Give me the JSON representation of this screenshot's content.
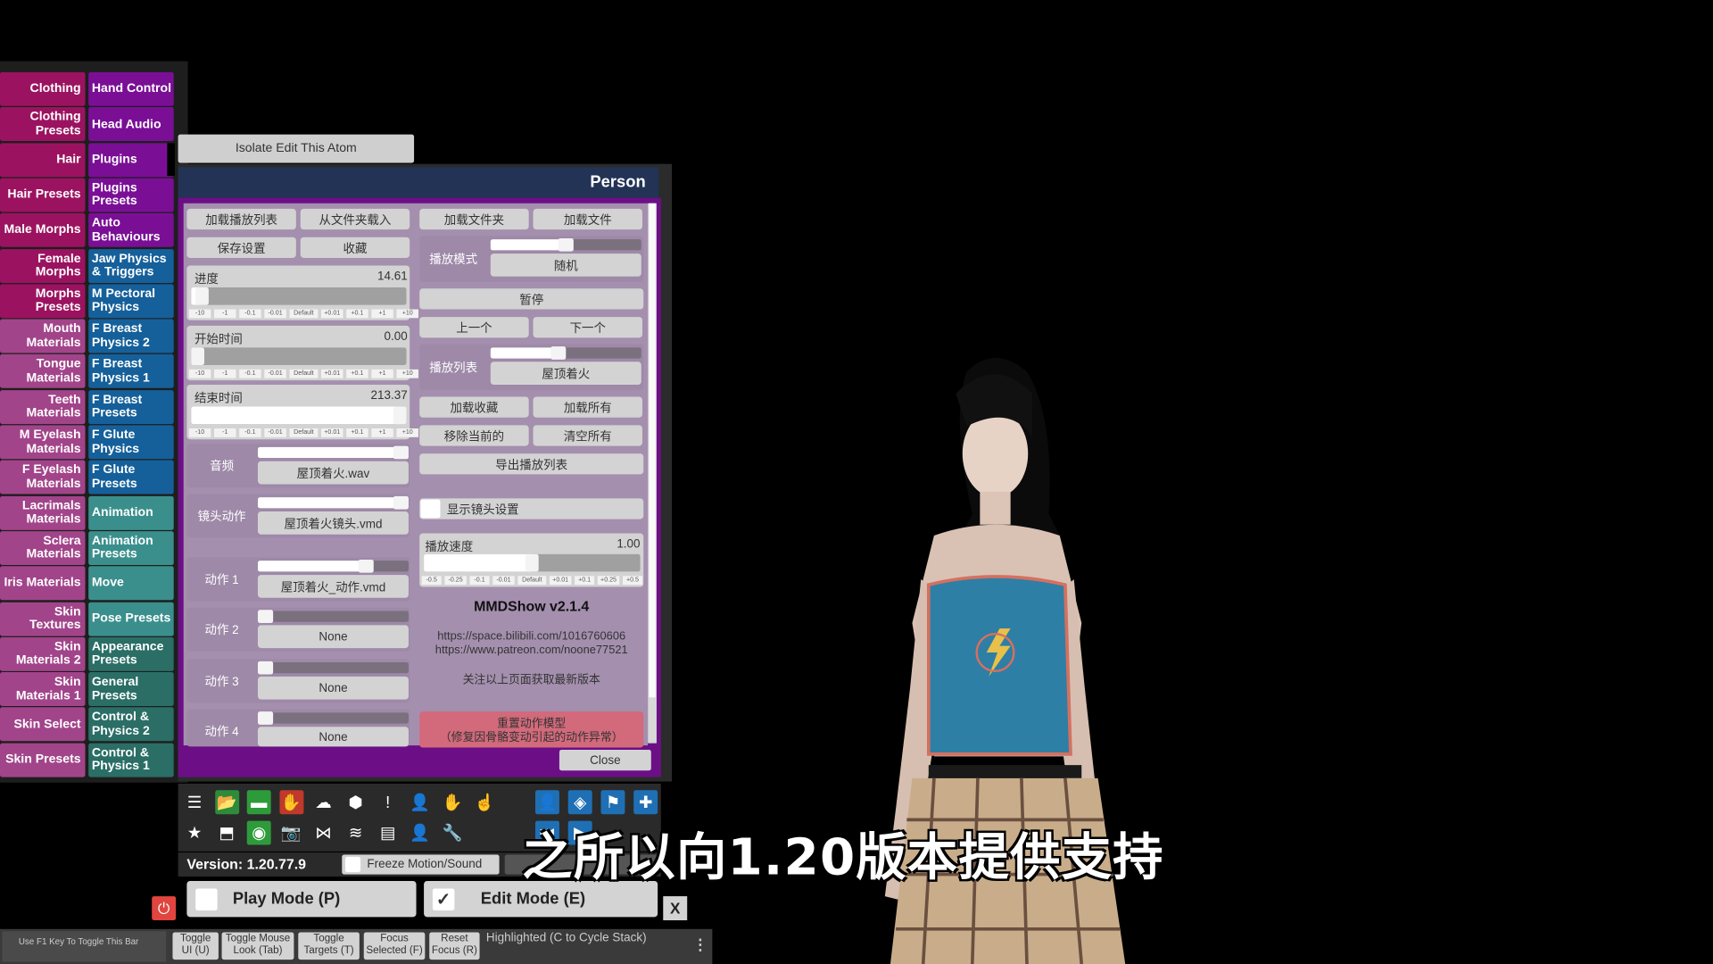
{
  "categories": {
    "left": [
      {
        "label": "Clothing",
        "color": "#9b1360"
      },
      {
        "label": "Clothing Presets",
        "color": "#9b1360"
      },
      {
        "label": "Hair",
        "color": "#9b1360"
      },
      {
        "label": "Hair Presets",
        "color": "#9b1360"
      },
      {
        "label": "Male Morphs",
        "color": "#9b1360"
      },
      {
        "label": "Female Morphs",
        "color": "#9b1360"
      },
      {
        "label": "Morphs Presets",
        "color": "#9b1360"
      },
      {
        "label": "Mouth Materials",
        "color": "#a2448a"
      },
      {
        "label": "Tongue Materials",
        "color": "#a2448a"
      },
      {
        "label": "Teeth Materials",
        "color": "#a2448a"
      },
      {
        "label": "M Eyelash Materials",
        "color": "#a2448a"
      },
      {
        "label": "F Eyelash Materials",
        "color": "#a2448a"
      },
      {
        "label": "Lacrimals Materials",
        "color": "#a2448a"
      },
      {
        "label": "Sclera Materials",
        "color": "#a2448a"
      },
      {
        "label": "Iris Materials",
        "color": "#a2448a"
      },
      {
        "label": "Skin Textures",
        "color": "#a2448a"
      },
      {
        "label": "Skin Materials 2",
        "color": "#a2448a"
      },
      {
        "label": "Skin Materials 1",
        "color": "#a2448a"
      },
      {
        "label": "Skin Select",
        "color": "#a2448a"
      },
      {
        "label": "Skin Presets",
        "color": "#a2448a"
      }
    ],
    "right": [
      {
        "label": "Hand Control",
        "color": "#7a0f96"
      },
      {
        "label": "Head Audio",
        "color": "#7a0f96"
      },
      {
        "label": "Plugins",
        "color": "#7a0f96"
      },
      {
        "label": "Plugins Presets",
        "color": "#7a0f96"
      },
      {
        "label": "Auto Behaviours",
        "color": "#7a0f96"
      },
      {
        "label": "Jaw Physics & Triggers",
        "color": "#15609a"
      },
      {
        "label": "M Pectoral Physics",
        "color": "#15609a"
      },
      {
        "label": "F Breast Physics 2",
        "color": "#15609a"
      },
      {
        "label": "F Breast Physics 1",
        "color": "#15609a"
      },
      {
        "label": "F Breast Presets",
        "color": "#15609a"
      },
      {
        "label": "F Glute Physics",
        "color": "#15609a"
      },
      {
        "label": "F Glute Presets",
        "color": "#15609a"
      },
      {
        "label": "Animation",
        "color": "#3a8f8c"
      },
      {
        "label": "Animation Presets",
        "color": "#3a8f8c"
      },
      {
        "label": "Move",
        "color": "#3a8f8c"
      },
      {
        "label": "Pose Presets",
        "color": "#3a8f8c"
      },
      {
        "label": "Appearance Presets",
        "color": "#2a6e66"
      },
      {
        "label": "General Presets",
        "color": "#2a6e66"
      },
      {
        "label": "Control & Physics 2",
        "color": "#2a6e66"
      },
      {
        "label": "Control & Physics 1",
        "color": "#2a6e66"
      }
    ]
  },
  "isolate_label": "Isolate Edit This Atom",
  "panel": {
    "title": "Person",
    "buttons": {
      "load_playlist": "加载播放列表",
      "load_from_folder": "从文件夹载入",
      "load_folder": "加载文件夹",
      "load_file": "加载文件",
      "save_settings": "保存设置",
      "favorites": "收藏",
      "pause": "暂停",
      "prev": "上一个",
      "next": "下一个",
      "load_favorites": "加载收藏",
      "load_all": "加载所有",
      "remove_current": "移除当前的",
      "clear_all": "清空所有",
      "export_playlist": "导出播放列表",
      "close": "Close"
    },
    "progress": {
      "label": "进度",
      "value": "14.61",
      "fraction": 0.05
    },
    "start_time": {
      "label": "开始时间",
      "value": "0.00",
      "fraction": 0.0
    },
    "end_time": {
      "label": "结束时间",
      "value": "213.37",
      "fraction": 1.0
    },
    "steps": [
      "-10",
      "-1",
      "-0.1",
      "-0.01",
      "Default",
      "+0.01",
      "+0.1",
      "+1",
      "+10"
    ],
    "play_mode": {
      "label": "播放模式",
      "value": "随机",
      "fraction": 0.5
    },
    "playlist": {
      "label": "播放列表",
      "value": "屋顶着火",
      "fraction": 0.45
    },
    "audio": {
      "label": "音频",
      "value": "屋顶着火.wav",
      "fraction": 0.95
    },
    "camera": {
      "label": "镜头动作",
      "value": "屋顶着火镜头.vmd",
      "fraction": 0.95
    },
    "motion1": {
      "label": "动作 1",
      "value": "屋顶着火_动作.vmd",
      "fraction": 0.72
    },
    "motion2": {
      "label": "动作 2",
      "value": "None",
      "fraction": 0.0
    },
    "motion3": {
      "label": "动作 3",
      "value": "None",
      "fraction": 0.0
    },
    "motion4": {
      "label": "动作 4",
      "value": "None",
      "fraction": 0.0
    },
    "show_camera_settings": {
      "label": "显示镜头设置",
      "checked": false
    },
    "speed": {
      "label": "播放速度",
      "value": "1.00",
      "fraction": 0.5
    },
    "speed_steps": [
      "-0.5",
      "-0.25",
      "-0.1",
      "-0.01",
      "Default",
      "+0.01",
      "+0.1",
      "+0.25",
      "+0.5"
    ],
    "plugin_title": "MMDShow v2.1.4",
    "url1": "https://space.bilibili.com/1016760606",
    "url2": "https://www.patreon.com/noone77521",
    "follow_note": "关注以上页面获取最新版本",
    "reset_line1": "重置动作模型",
    "reset_line2": "（修复因骨骼变动引起的动作异常）"
  },
  "toolbar": {
    "row1": [
      "menu-icon",
      "open-scene-icon",
      "folder-icon",
      "hand-red-icon",
      "cloud-icon",
      "package-icon",
      "alert-icon",
      "person-add-icon",
      "hand-icon",
      "pointer-icon",
      "person-icon",
      "unity-icon",
      "flag-icon",
      "plus-icon"
    ],
    "row2": [
      "star-icon",
      "load-icon",
      "screenshot-icon",
      "camera-icon",
      "nodes-icon",
      "layers-icon",
      "document-icon",
      "person-remove-icon",
      "wrench-icon",
      "skip-back-icon",
      "play-icon"
    ]
  },
  "version": "Version: 1.20.77.9",
  "freeze_label": "Freeze Motion/Sound",
  "play_mode_label": "Play Mode (P)",
  "edit_mode_label": "Edit Mode (E)",
  "edit_checked": "✓",
  "x_label": "X",
  "bottom": {
    "f1_hint": "Use F1 Key To Toggle This Bar",
    "buttons": [
      {
        "l1": "Toggle",
        "l2": "UI (U)"
      },
      {
        "l1": "Toggle Mouse",
        "l2": "Look (Tab)"
      },
      {
        "l1": "Toggle",
        "l2": "Targets (T)"
      },
      {
        "l1": "Focus",
        "l2": "Selected (F)"
      },
      {
        "l1": "Reset",
        "l2": "Focus (R)"
      }
    ],
    "highlighted": "Highlighted (C to Cycle Stack)"
  },
  "subtitle": "之所以向1.20版本提供支持"
}
